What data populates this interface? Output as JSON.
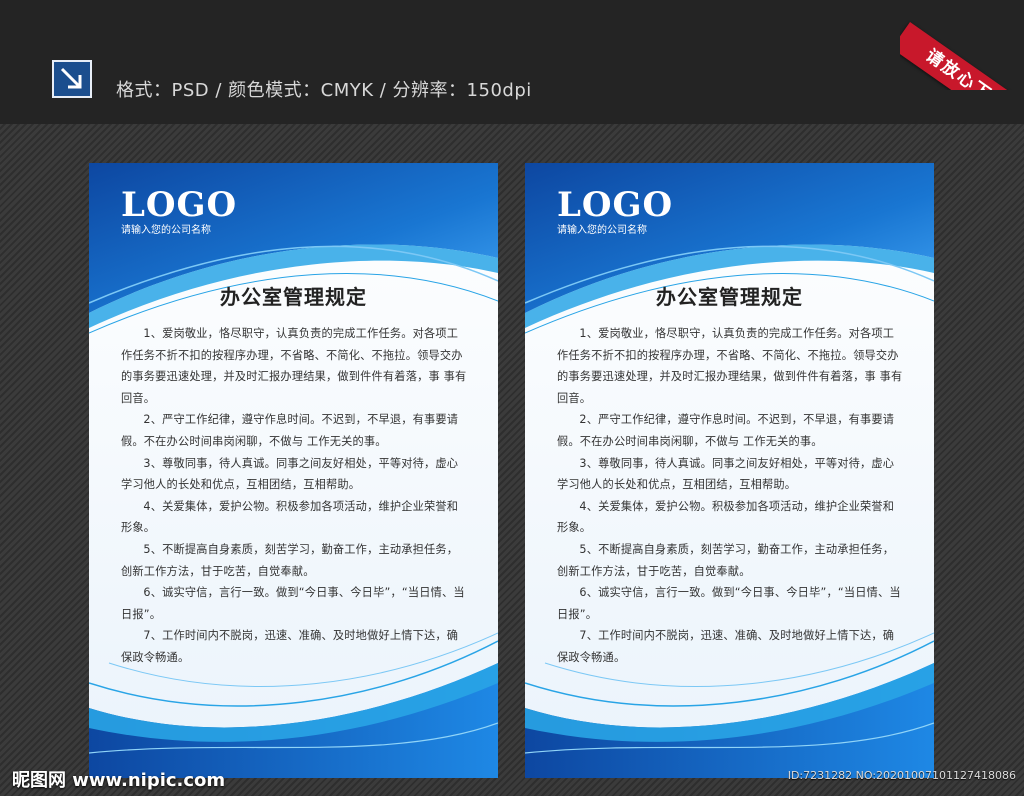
{
  "header": {
    "format_info": "格式：PSD  /  颜色模式：CMYK  /  分辨率：150dpi",
    "ribbon_text": "请放心下载"
  },
  "poster": {
    "logo": "LOGO",
    "company_placeholder": "请输入您的公司名称",
    "title": "办公室管理规定",
    "rules": [
      "1、爱岗敬业，恪尽职守，认真负责的完成工作任务。对各项工作任务不折不扣的按程序办理，不省略、不简化、不拖拉。领导交办的事务要迅速处理，并及时汇报办理结果，做到件件有着落，事 事有回音。",
      "2、严守工作纪律，遵守作息时间。不迟到，不早退，有事要请假。不在办公时间串岗闲聊，不做与  工作无关的事。",
      "3、尊敬同事，待人真诚。同事之间友好相处，平等对待，虚心学习他人的长处和优点，互相团结，互相帮助。",
      "4、关爱集体，爱护公物。积极参加各项活动，维护企业荣誉和形象。",
      "5、不断提高自身素质，刻苦学习，勤奋工作，主动承担任务，创新工作方法，甘于吃苦，自觉奉献。",
      "6、诚实守信，言行一致。做到“今日事、今日毕”，“当日情、当日报”。",
      "7、工作时间内不脱岗，迅速、准确、及时地做好上情下达，确保政令畅通。"
    ]
  },
  "watermark": {
    "site": "昵图网 www.nipic.com",
    "id_text": "ID:7231282 NO:20201007101127418086"
  },
  "colors": {
    "header_bg": "#242424",
    "poster_blue": "#1565c0",
    "poster_light_blue": "#29a4e6",
    "ribbon_red": "#c8182b"
  }
}
